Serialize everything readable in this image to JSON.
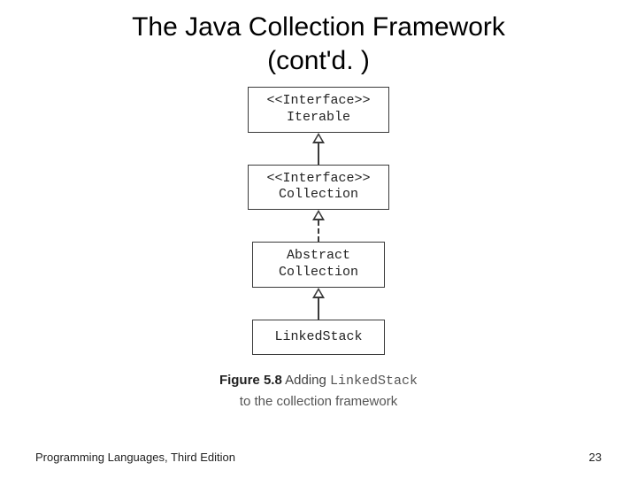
{
  "title_line1": "The Java Collection Framework",
  "title_line2": "(cont'd. )",
  "nodes": {
    "iterable": {
      "stereo": "<<Interface>>",
      "name": "Iterable"
    },
    "collection": {
      "stereo": "<<Interface>>",
      "name": "Collection"
    },
    "abstractcollection": {
      "line1": "Abstract",
      "line2": "Collection"
    },
    "linkedstack": {
      "name": "LinkedStack"
    }
  },
  "caption": {
    "figref": "Figure 5.8",
    "lead": "Adding",
    "mono": "LinkedStack",
    "line2": "to the collection framework"
  },
  "footer": {
    "left": "Programming Languages, Third Edition",
    "right": "23"
  }
}
